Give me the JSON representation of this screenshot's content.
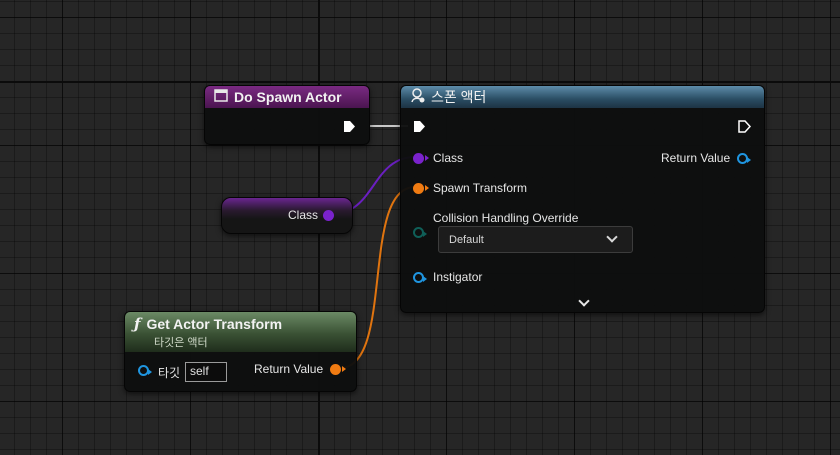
{
  "nodes": {
    "do_spawn": {
      "title": "Do Spawn Actor",
      "header_color": "#6a1f6e"
    },
    "spawn": {
      "title": "스폰 액터",
      "class_label": "Class",
      "return_label": "Return Value",
      "transform_label": "Spawn Transform",
      "collision_label": "Collision Handling Override",
      "collision_value": "Default",
      "instigator_label": "Instigator"
    },
    "class_var": {
      "label": "Class"
    },
    "get_transform": {
      "title": "Get Actor Transform",
      "subtitle": "타깃은 액터",
      "target_label": "타깃",
      "target_value": "self",
      "return_label": "Return Value",
      "icon": "function-icon"
    }
  },
  "colors": {
    "class_pin": "#7a22cc",
    "transform_pin": "#f07b12",
    "object_pin": "#1f95e0",
    "collision_pin": "#0f5f58",
    "exec": "#ffffff"
  }
}
